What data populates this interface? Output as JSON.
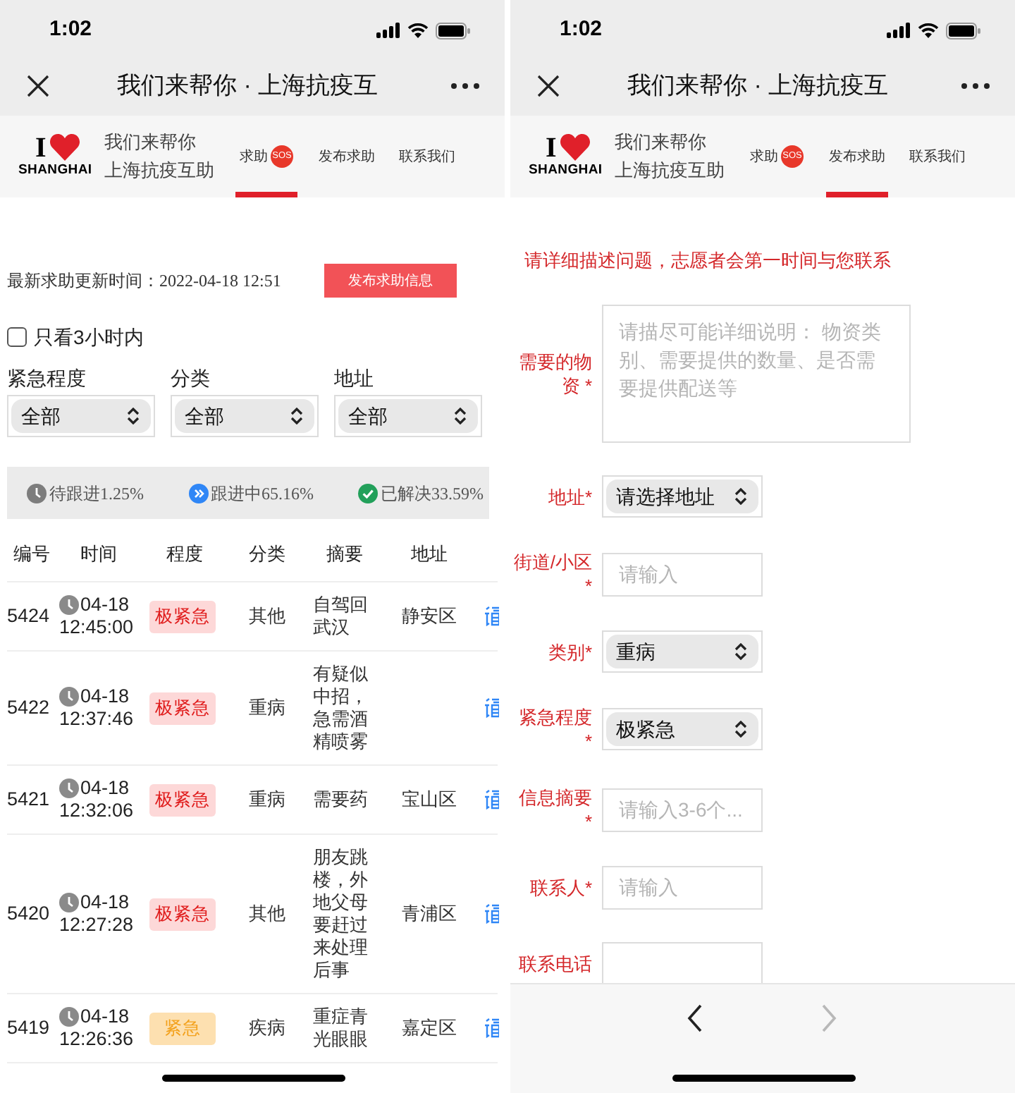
{
  "screens": [
    {
      "kind": "help_list",
      "status_bar": {
        "time": "1:02"
      },
      "nav": {
        "title": "我们来帮你 · 上海抗疫互"
      },
      "header": {
        "logo": {
          "top": "I",
          "bottom": "SHANGHAI"
        },
        "site_name": [
          "我们来帮你",
          "上海抗疫互助"
        ],
        "tabs": [
          {
            "label": "求助",
            "badge": "SOS",
            "selected": true
          },
          {
            "label": "发布求助",
            "selected": false
          },
          {
            "label": "联系我们",
            "selected": false
          }
        ]
      },
      "content": {
        "update": "最新求助更新时间：2022-04-18 12:51",
        "post_button": "发布求助信息",
        "recent_filter": {
          "label": "只看3小时内",
          "checked": false
        },
        "filters": [
          {
            "label": "紧急程度",
            "value": "全部"
          },
          {
            "label": "分类",
            "value": "全部"
          },
          {
            "label": "地址",
            "value": "全部"
          }
        ],
        "stats": [
          {
            "kind": "pending",
            "text": "待跟进1.25%"
          },
          {
            "kind": "in_progress",
            "text": "跟进中65.16%"
          },
          {
            "kind": "resolved",
            "text": "已解决33.59%"
          }
        ],
        "table": {
          "columns": [
            "编号",
            "时间",
            "程度",
            "分类",
            "摘要",
            "地址"
          ],
          "rows": [
            {
              "id": "5424",
              "date": "04-18",
              "time": "12:45:00",
              "urgency": {
                "text": "极紧急",
                "kind": "critical"
              },
              "category": "其他",
              "summary": "自驾回武汉",
              "address": "静安区"
            },
            {
              "id": "5422",
              "date": "04-18",
              "time": "12:37:46",
              "urgency": {
                "text": "极紧急",
                "kind": "critical"
              },
              "category": "重病",
              "summary": "有疑似中招，急需酒精喷雾"
            },
            {
              "id": "5421",
              "date": "04-18",
              "time": "12:32:06",
              "urgency": {
                "text": "极紧急",
                "kind": "critical"
              },
              "category": "重病",
              "summary": "需要药",
              "address": "宝山区"
            },
            {
              "id": "5420",
              "date": "04-18",
              "time": "12:27:28",
              "urgency": {
                "text": "极紧急",
                "kind": "critical"
              },
              "category": "其他",
              "summary": "朋友跳楼，外地父母要赶过来处理后事",
              "address": "青浦区"
            },
            {
              "id": "5419",
              "date": "04-18",
              "time": "12:26:36",
              "urgency": {
                "text": "紧急",
                "kind": "urgent"
              },
              "category": "疾病",
              "summary": "重症青光眼眼",
              "address": "嘉定区"
            }
          ]
        }
      }
    },
    {
      "kind": "post_form",
      "status_bar": {
        "time": "1:02"
      },
      "nav": {
        "title": "我们来帮你 · 上海抗疫互"
      },
      "header": {
        "logo": {
          "top": "I",
          "bottom": "SHANGHAI"
        },
        "site_name": [
          "我们来帮你",
          "上海抗疫互助"
        ],
        "tabs": [
          {
            "label": "求助",
            "badge": "SOS",
            "selected": false
          },
          {
            "label": "发布求助",
            "selected": true
          },
          {
            "label": "联系我们",
            "selected": false
          }
        ]
      },
      "content": {
        "notice": "请详细描述问题，志愿者会第一时间与您联系",
        "fields": [
          {
            "kind": "textarea",
            "label": "需要的物资 *",
            "placeholder": "请描尽可能详细说明：  物资类别、需要提供的数量、是否需要提供配送等"
          },
          {
            "kind": "select",
            "label": "地址*",
            "value": "请选择地址"
          },
          {
            "kind": "input",
            "label": "街道/小区 *",
            "placeholder": "请输入"
          },
          {
            "kind": "select",
            "label": "类别*",
            "value": "重病"
          },
          {
            "kind": "select",
            "label": "紧急程度 *",
            "value": "极紧急"
          },
          {
            "kind": "input",
            "label": "信息摘要 *",
            "placeholder": "请输入3-6个..."
          },
          {
            "kind": "input",
            "label": "联系人*",
            "placeholder": "请输入"
          },
          {
            "kind": "input",
            "label": "联系电话"
          }
        ],
        "nav_buttons": [
          {
            "kind": "back",
            "disabled": false
          },
          {
            "kind": "forward",
            "disabled": true
          }
        ]
      }
    }
  ]
}
